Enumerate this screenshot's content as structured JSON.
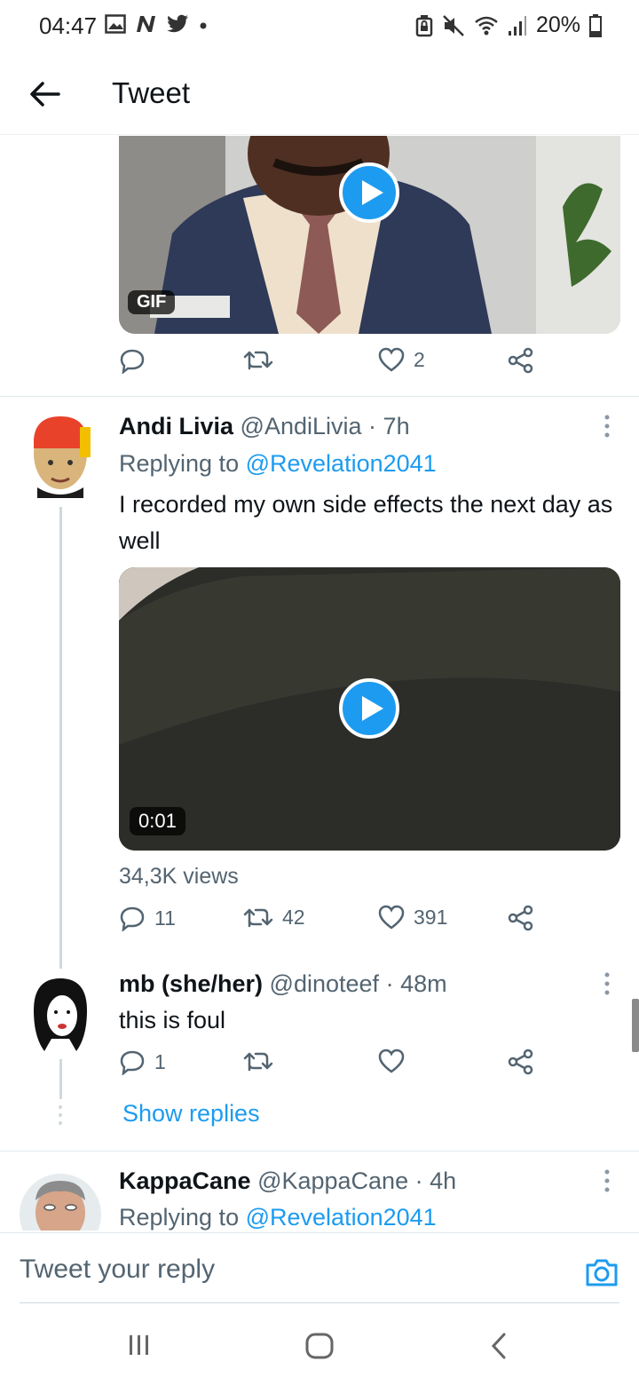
{
  "status_bar": {
    "time": "04:47",
    "battery": "20%",
    "left_icons": [
      "image-icon",
      "n-icon",
      "bird-icon",
      "dot-icon"
    ],
    "right_icons": [
      "lock-battery-icon",
      "mute-icon",
      "wifi-icon",
      "signal-icon",
      "battery-icon"
    ]
  },
  "header": {
    "title": "Tweet"
  },
  "prev_tweet": {
    "media_badge": "GIF",
    "actions": {
      "reply": "",
      "retweet": "",
      "like": "2"
    }
  },
  "tweets": [
    {
      "name": "Andi Livia",
      "handle": "@AndiLivia",
      "time": "7h",
      "replying_prefix": "Replying to",
      "replying_to": "@Revelation2041",
      "text": "I recorded my own side effects the next day as well",
      "video_duration": "0:01",
      "views": "34,3K views",
      "actions": {
        "reply": "11",
        "retweet": "42",
        "like": "391"
      }
    },
    {
      "name": "mb (she/her)",
      "handle": "@dinoteef",
      "time": "48m",
      "text": "this is foul",
      "actions": {
        "reply": "1",
        "retweet": "",
        "like": ""
      },
      "show_replies": "Show replies"
    },
    {
      "name": "KappaCane",
      "handle": "@KappaCane",
      "time": "4h",
      "replying_prefix": "Replying to",
      "replying_to": "@Revelation2041"
    }
  ],
  "reply_box": {
    "placeholder": "Tweet your reply"
  },
  "colors": {
    "accent": "#1d9bf0",
    "text": "#0f1419",
    "secondary": "#536471"
  }
}
